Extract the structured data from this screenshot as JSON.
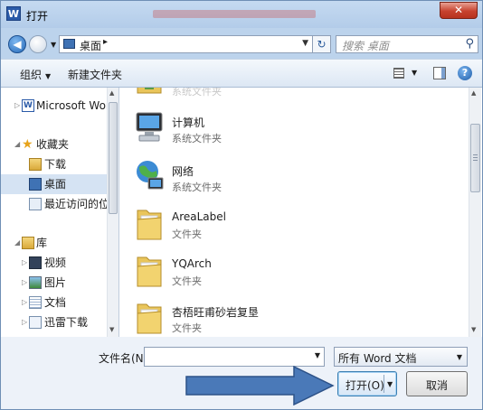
{
  "window": {
    "title": "打开",
    "app_icon_letter": "W",
    "close_glyph": "✕"
  },
  "address": {
    "location": "桌面",
    "separator": "▸",
    "refresh_glyph": "↻"
  },
  "search": {
    "placeholder": "搜索 桌面",
    "icon": "search-icon"
  },
  "toolbar": {
    "organize_label": "组织",
    "new_folder_label": "新建文件夹"
  },
  "navigation": {
    "items": [
      {
        "label": "Microsoft Word",
        "icon": "word-doc-icon"
      },
      {
        "label": "收藏夹",
        "icon": "star-icon"
      },
      {
        "label": "下载",
        "icon": "download-folder-icon"
      },
      {
        "label": "桌面",
        "icon": "desktop-icon",
        "selected": true
      },
      {
        "label": "最近访问的位置",
        "icon": "recent-places-icon"
      },
      {
        "label": "库",
        "icon": "library-icon"
      },
      {
        "label": "视频",
        "icon": "video-icon"
      },
      {
        "label": "图片",
        "icon": "picture-icon"
      },
      {
        "label": "文档",
        "icon": "document-icon"
      },
      {
        "label": "迅雷下载",
        "icon": "xunlei-icon"
      }
    ]
  },
  "files": [
    {
      "name": "计算机",
      "type": "系统文件夹",
      "icon": "computer-icon"
    },
    {
      "name": "网络",
      "type": "系统文件夹",
      "icon": "network-icon"
    },
    {
      "name": "AreaLabel",
      "type": "文件夹",
      "icon": "folder-icon"
    },
    {
      "name": "YQArch",
      "type": "文件夹",
      "icon": "folder-icon"
    },
    {
      "name": "杏梧旺甫砂岩复垦",
      "type": "文件夹",
      "icon": "folder-icon"
    }
  ],
  "footer": {
    "filename_label": "文件名(N):",
    "filename_value": "",
    "filetype_value": "所有 Word 文档",
    "open_label": "打开(O)",
    "cancel_label": "取消"
  },
  "colors": {
    "annotation_arrow": "#4a79b8",
    "selection": "#d5e3f3"
  }
}
